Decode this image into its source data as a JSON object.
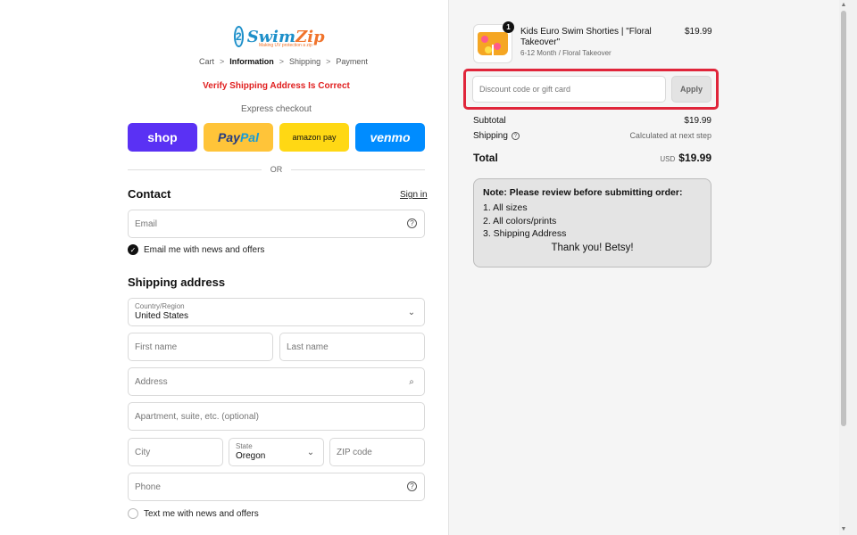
{
  "brand": {
    "logo_text_a": "Swim",
    "logo_text_b": "Zip",
    "logo_mark": "2",
    "tagline": "Making UV protection a zip"
  },
  "breadcrumb": {
    "items": [
      "Cart",
      "Information",
      "Shipping",
      "Payment"
    ],
    "separator": ">"
  },
  "alert": {
    "text": "Verify Shipping Address Is Correct"
  },
  "express": {
    "title": "Express checkout",
    "shop": "shop",
    "paypal_a": "Pay",
    "paypal_b": "Pal",
    "amazon": "amazon pay",
    "venmo": "venmo"
  },
  "divider": {
    "text": "OR"
  },
  "contact": {
    "title": "Contact",
    "signin": "Sign in",
    "email_placeholder": "Email",
    "news_checkbox": "Email me with news and offers"
  },
  "shipping": {
    "title": "Shipping address",
    "country_label": "Country/Region",
    "country_value": "United States",
    "first_name": "First name",
    "last_name": "Last name",
    "address": "Address",
    "apartment": "Apartment, suite, etc. (optional)",
    "city": "City",
    "state_label": "State",
    "state_value": "Oregon",
    "zip": "ZIP code",
    "phone": "Phone",
    "text_checkbox": "Text me with news and offers"
  },
  "order": {
    "item_name": "Kids Euro Swim Shorties | \"Floral Takeover\"",
    "item_variant": "6-12 Month / Floral Takeover",
    "item_price": "$19.99",
    "item_qty": "1",
    "discount_placeholder": "Discount code or gift card",
    "apply": "Apply",
    "subtotal_label": "Subtotal",
    "subtotal_value": "$19.99",
    "shipping_label": "Shipping",
    "shipping_value": "Calculated at next step",
    "total_label": "Total",
    "currency": "USD",
    "total_value": "$19.99"
  },
  "note": {
    "title": "Note: Please review before submitting order:",
    "lines": [
      "1. All sizes",
      "2. All colors/prints",
      "3. Shipping Address"
    ],
    "thanks": "Thank you! Betsy!"
  },
  "colors": {
    "alert": "#e02020",
    "shop": "#5a31f4",
    "paypal": "#ffc439",
    "amazon": "#ffd814",
    "venmo": "#008cff",
    "highlight": "#e0253a"
  }
}
